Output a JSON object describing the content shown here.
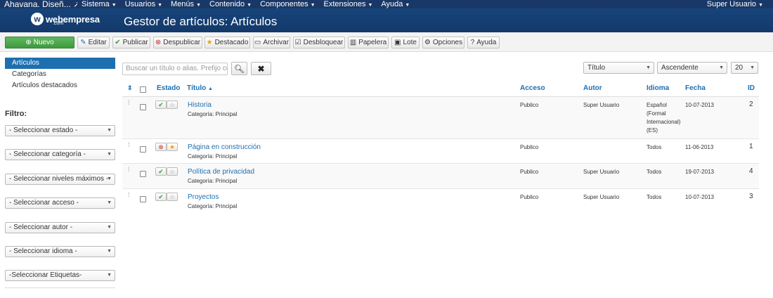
{
  "topnav": {
    "brand": "Ahavana. Diseñ...",
    "menu": [
      "Sistema",
      "Usuarios",
      "Menús",
      "Contenido",
      "Componentes",
      "Extensiones",
      "Ayuda"
    ],
    "user": "Super Usuario"
  },
  "header": {
    "logo_text": "webempresa",
    "logo_sub": ".com",
    "title": "Gestor de artículos: Artículos"
  },
  "toolbar": {
    "nuevo": "Nuevo",
    "editar": "Editar",
    "publicar": "Publicar",
    "despublicar": "Despublicar",
    "destacado": "Destacado",
    "archivar": "Archivar",
    "desbloquear": "Desbloquear",
    "papelera": "Papelera",
    "lote": "Lote",
    "opciones": "Opciones",
    "ayuda": "Ayuda"
  },
  "sidebar": {
    "items": [
      "Artículos",
      "Categorías",
      "Artículos destacados"
    ],
    "filter_title": "Filtro:",
    "filters": [
      "- Seleccionar estado -",
      "- Seleccionar categoría -",
      "- Seleccionar niveles máximos -",
      "- Seleccionar acceso -",
      "- Seleccionar autor -",
      "- Seleccionar idioma -",
      "-Seleccionar Etiquetas-"
    ]
  },
  "search": {
    "placeholder": "Buscar un título o alias. Prefijo con 'ID:' para buscar un ID"
  },
  "list_controls": {
    "order_by": "Título",
    "direction": "Ascendente",
    "limit": "20"
  },
  "table": {
    "headers": {
      "estado": "Estado",
      "titulo": "Título",
      "acceso": "Acceso",
      "autor": "Autor",
      "idioma": "Idioma",
      "fecha": "Fecha",
      "id": "ID"
    },
    "category_prefix": "Categoría: ",
    "rows": [
      {
        "title": "Historia",
        "category": "Principal",
        "access": "Publico",
        "author": "Super Usuario",
        "language": [
          "Español",
          "(Formal",
          "Internacional)",
          "(ES)"
        ],
        "date": "10-07-2013",
        "id": "2",
        "published": true,
        "featured": false
      },
      {
        "title": "Página en construcción",
        "category": "Principal",
        "access": "Publico",
        "author": "",
        "language": [
          "Todos"
        ],
        "date": "11-06-2013",
        "id": "1",
        "published": false,
        "featured": true
      },
      {
        "title": "Política de privacidad",
        "category": "Principal",
        "access": "Publico",
        "author": "Super Usuario",
        "language": [
          "Todos"
        ],
        "date": "19-07-2013",
        "id": "4",
        "published": true,
        "featured": false
      },
      {
        "title": "Proyectos",
        "category": "Principal",
        "access": "Publico",
        "author": "Super Usuario",
        "language": [
          "Todos"
        ],
        "date": "10-07-2013",
        "id": "3",
        "published": true,
        "featured": false
      }
    ]
  },
  "colors": {
    "nav_bg": "#1a3867",
    "header_bg": "#17447a",
    "accent": "#1e6fb0",
    "new_button": "#4aa84a",
    "published": "#3c9a3c",
    "unpublished": "#c9302c",
    "featured": "#f0a30a"
  }
}
